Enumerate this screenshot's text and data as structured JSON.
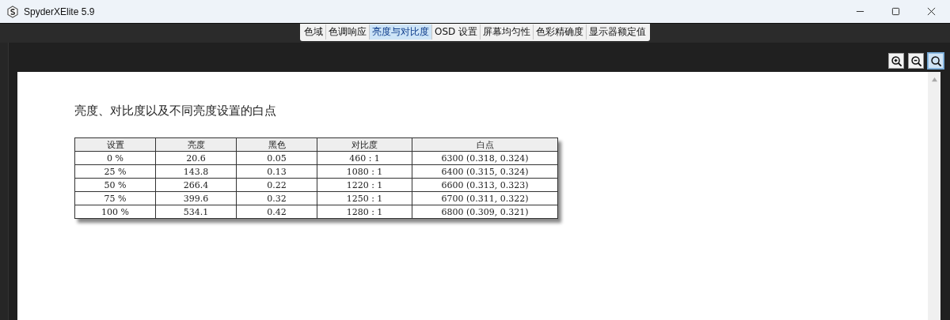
{
  "window": {
    "title": "SpyderXElite 5.9"
  },
  "tabs": [
    {
      "label": "色域",
      "selected": false
    },
    {
      "label": "色调响应",
      "selected": false
    },
    {
      "label": "亮度与对比度",
      "selected": true
    },
    {
      "label": "OSD 设置",
      "selected": false
    },
    {
      "label": "屏幕均匀性",
      "selected": false
    },
    {
      "label": "色彩精确度",
      "selected": false
    },
    {
      "label": "显示器额定值",
      "selected": false
    }
  ],
  "zoom_tools": [
    {
      "kind": "zoom-in",
      "selected": false
    },
    {
      "kind": "zoom-out",
      "selected": false
    },
    {
      "kind": "fit",
      "selected": true
    }
  ],
  "report": {
    "heading": "亮度、对比度以及不同亮度设置的白点",
    "table": {
      "columns": [
        "设置",
        "亮度",
        "黑色",
        "对比度",
        "白点"
      ],
      "rows": [
        [
          "0 %",
          "20.6",
          "0.05",
          "460 : 1",
          "6300 (0.318, 0.324)"
        ],
        [
          "25 %",
          "143.8",
          "0.13",
          "1080 : 1",
          "6400 (0.315, 0.324)"
        ],
        [
          "50 %",
          "266.4",
          "0.22",
          "1220 : 1",
          "6600 (0.313, 0.323)"
        ],
        [
          "75 %",
          "399.6",
          "0.32",
          "1250 : 1",
          "6700 (0.311, 0.322)"
        ],
        [
          "100 %",
          "534.1",
          "0.42",
          "1280 : 1",
          "6800 (0.309, 0.321)"
        ]
      ]
    }
  }
}
